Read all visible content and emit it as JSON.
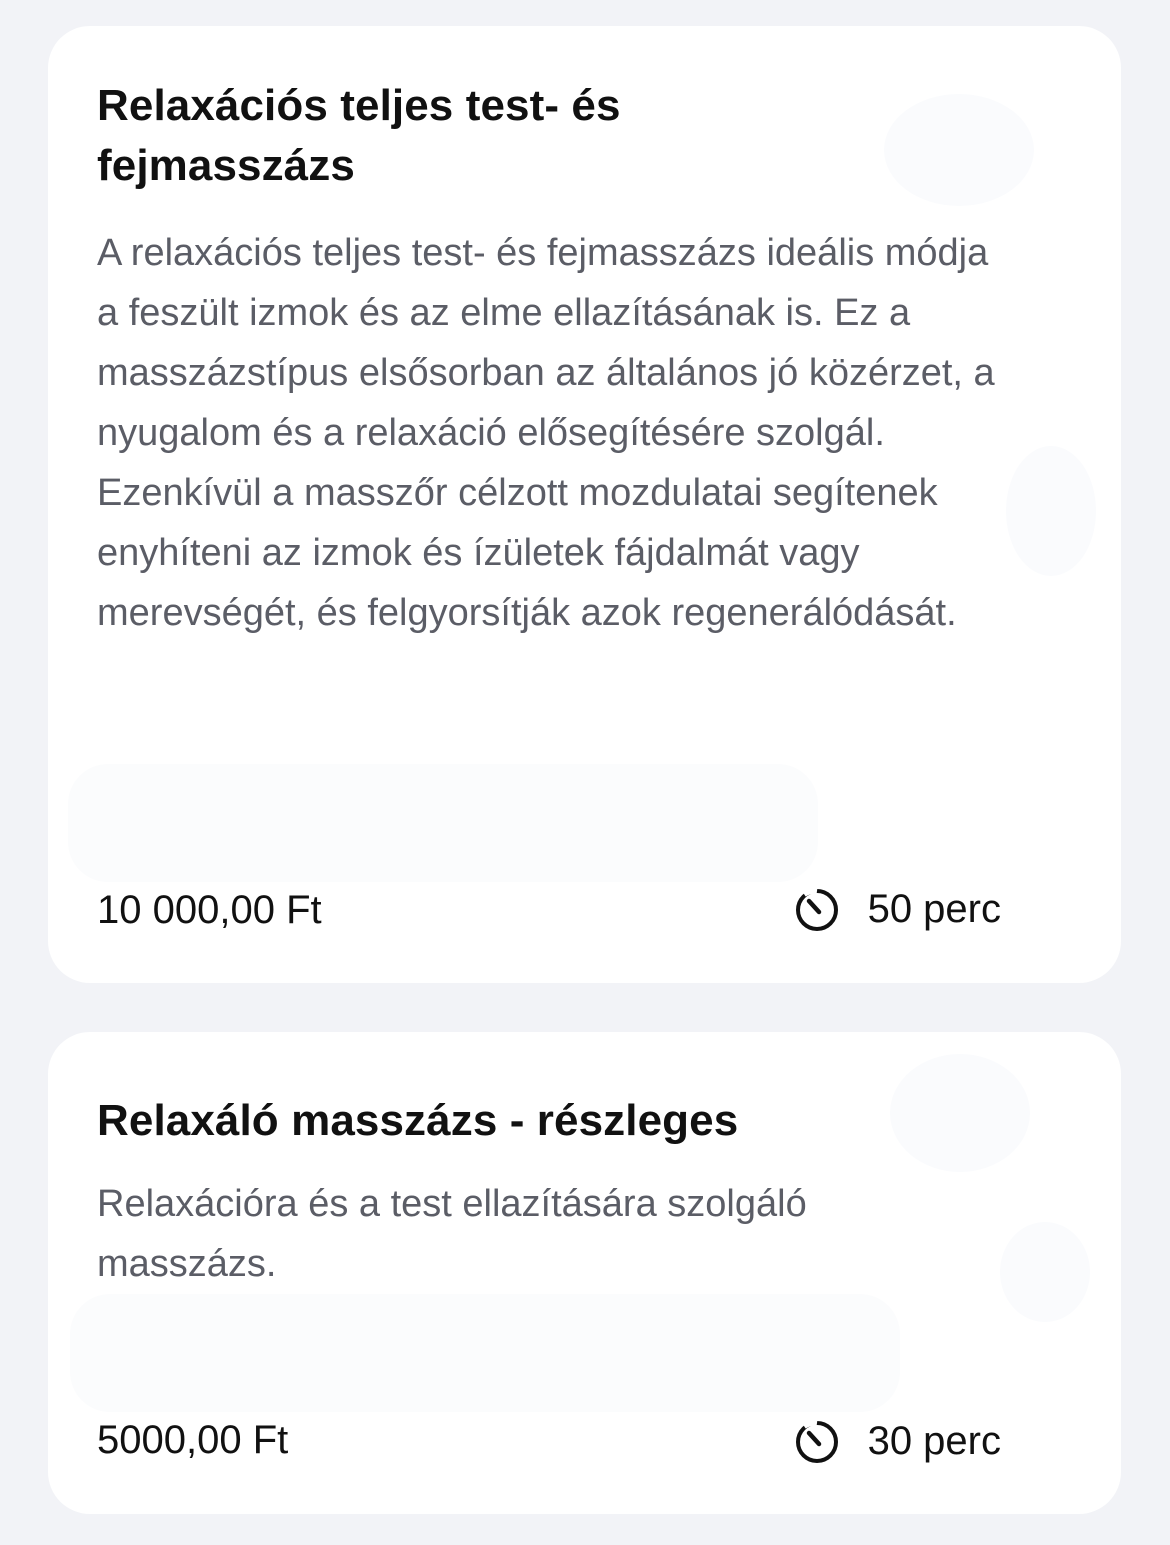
{
  "services": [
    {
      "title": "Relaxációs teljes test- és fejmasszázs",
      "description": "A relaxációs teljes test- és fejmasszázs ideális módja a feszült izmok és az elme ellazításának is. Ez a masszázstípus elsősorban az általános jó közérzet, a nyugalom és a relaxáció elősegítésére szolgál. Ezenkívül a masszőr célzott mozdulatai segítenek enyhíteni az izmok és ízületek fájdalmát vagy merevségét, és felgyorsítják azok regenerálódását.",
      "price": "10 000,00 Ft",
      "duration": "50 perc",
      "duration_icon": "timer-icon"
    },
    {
      "title": "Relaxáló masszázs - részleges",
      "description": "Relaxációra és a test ellazítására szolgáló masszázs.",
      "price": "5000,00 Ft",
      "duration": "30 perc",
      "duration_icon": "timer-icon"
    }
  ]
}
